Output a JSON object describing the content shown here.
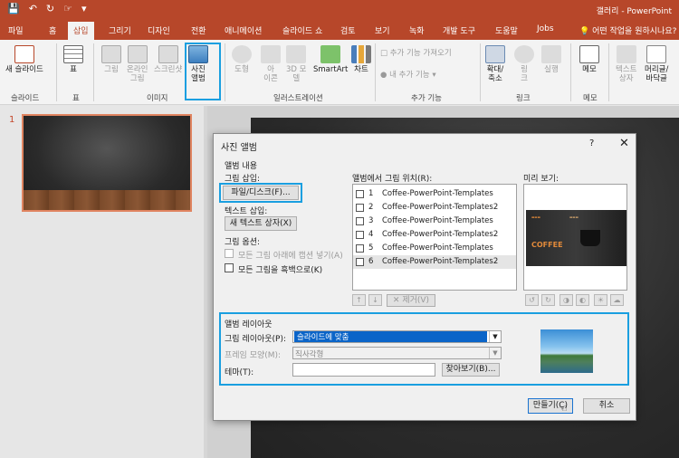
{
  "app": {
    "window_title": "갤러리 - PowerPoint",
    "qat": [
      "save-icon",
      "undo-icon",
      "redo-icon",
      "touch-mode-icon",
      "customize-icon"
    ]
  },
  "tabs": [
    "파일",
    "홈",
    "삽입",
    "그리기",
    "디자인",
    "전환",
    "애니메이션",
    "슬라이드 쇼",
    "검토",
    "보기",
    "녹화",
    "개발 도구",
    "도움말",
    "Jobs"
  ],
  "active_tab": "삽입",
  "tell_me": "어떤 작업을 원하시나요?",
  "ribbon": {
    "new_slide": "새 슬라이드",
    "table": "표",
    "picture": "그림",
    "online_picture_1": "온라인",
    "online_picture_2": "그림",
    "screenshot": "스크린샷",
    "photo_album_1": "사진",
    "photo_album_2": "앨범",
    "shapes": "도형",
    "icons_1": "아",
    "icons_2": "이콘",
    "models_1": "3D 모",
    "models_2": "델",
    "smartart": "SmartArt",
    "chart": "차트",
    "get_addins": "추가 기능 가져오기",
    "my_addins": "내 추가 기능",
    "zoom_1": "확대/",
    "zoom_2": "축소",
    "link_1": "링",
    "link_2": "크",
    "action": "실행",
    "comment": "메모",
    "textbox_1": "텍스트",
    "textbox_2": "상자",
    "header_1": "머리글/",
    "header_2": "바닥글",
    "groups": {
      "slides": "슬라이드",
      "tables": "표",
      "images": "이미지",
      "illustrations": "일러스트레이션",
      "addins": "추가 기능",
      "links": "링크",
      "comments": "메모"
    }
  },
  "slides_panel": {
    "slide_number": "1"
  },
  "dialog": {
    "title": "사진 앨범",
    "help": "?",
    "close": "✕",
    "album_content": "앨범 내용",
    "insert_picture_from": "그림 삽입:",
    "file_disk_button": "파일/디스크(F)...",
    "insert_text": "텍스트 삽입:",
    "new_text_box_button": "새 텍스트 상자(X)",
    "picture_options": "그림 옵션:",
    "captions_below": "모든 그림 아래에 캡션 넣기(A)",
    "all_black_white": "모든 그림을 흑백으로(K)",
    "pictures_in_album": "앨범에서 그림 위치(R):",
    "preview": "미리 보기:",
    "pictures": [
      {
        "no": "1",
        "name": "Coffee-PowerPoint-Templates"
      },
      {
        "no": "2",
        "name": "Coffee-PowerPoint-Templates2"
      },
      {
        "no": "3",
        "name": "Coffee-PowerPoint-Templates"
      },
      {
        "no": "4",
        "name": "Coffee-PowerPoint-Templates2"
      },
      {
        "no": "5",
        "name": "Coffee-PowerPoint-Templates"
      },
      {
        "no": "6",
        "name": "Coffee-PowerPoint-Templates2"
      }
    ],
    "preview_word": "COFFEE",
    "remove_button": "제거(V)",
    "album_layout": "앨범 레이아웃",
    "picture_layout_label": "그림 레이아웃(P):",
    "picture_layout_value": "슬라이드에 맞춤",
    "frame_shape_label": "프레임 모양(M):",
    "frame_shape_value": "직사각형",
    "theme_label": "테마(T):",
    "theme_value": "",
    "browse_button": "찾아보기(B)...",
    "create_button": "만들기(C)",
    "cancel_button": "취소"
  }
}
